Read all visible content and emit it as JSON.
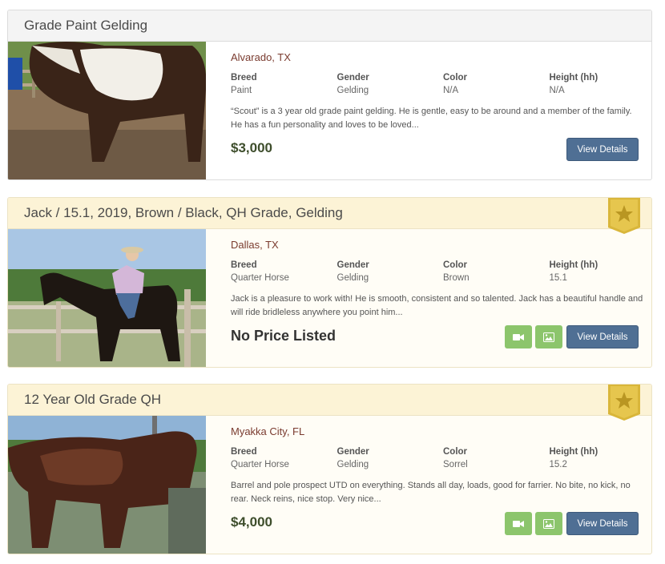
{
  "listings": [
    {
      "title": "Grade Paint Gelding",
      "location": "Alvarado, TX",
      "attributes": [
        {
          "label": "Breed",
          "value": "Paint"
        },
        {
          "label": "Gender",
          "value": "Gelding"
        },
        {
          "label": "Color",
          "value": "N/A"
        },
        {
          "label": "Height (hh)",
          "value": "N/A"
        }
      ],
      "description": "“Scout” is a 3 year old grade paint gelding. He is gentle, easy to be around and a member of the family. He has a fun personality and loves to be loved...",
      "price": "$3,000",
      "details_label": "View Details"
    },
    {
      "title": "Jack / 15.1, 2019, Brown / Black, QH Grade, Gelding",
      "location": "Dallas, TX",
      "attributes": [
        {
          "label": "Breed",
          "value": "Quarter Horse"
        },
        {
          "label": "Gender",
          "value": "Gelding"
        },
        {
          "label": "Color",
          "value": "Brown"
        },
        {
          "label": "Height (hh)",
          "value": "15.1"
        }
      ],
      "description": "Jack is a pleasure to work with! He is smooth, consistent and so talented. Jack has a beautiful handle and will ride bridleless anywhere you point him...",
      "price": "No Price Listed",
      "details_label": "View Details"
    },
    {
      "title": "12 Year Old Grade QH",
      "location": "Myakka City, FL",
      "attributes": [
        {
          "label": "Breed",
          "value": "Quarter Horse"
        },
        {
          "label": "Gender",
          "value": "Gelding"
        },
        {
          "label": "Color",
          "value": "Sorrel"
        },
        {
          "label": "Height (hh)",
          "value": "15.2"
        }
      ],
      "description": "Barrel and pole prospect UTD on everything. Stands all day, loads, good for farrier. No bite, no kick, no rear. Neck reins, nice stop. Very nice...",
      "price": "$4,000",
      "details_label": "View Details"
    }
  ],
  "icons": {
    "featured": "star-ribbon-icon",
    "video": "video-camera-icon",
    "photos": "image-icon"
  },
  "colors": {
    "details_button": "#4f6f94",
    "media_button": "#8cc56c",
    "featured_header": "#fcf3d6",
    "price": "#3e4e2c",
    "location": "#7a3b2f",
    "ribbon": "#d9b63a"
  }
}
